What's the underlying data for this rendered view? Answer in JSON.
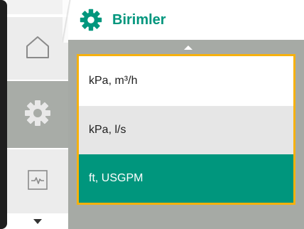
{
  "header": {
    "title": "Birimler",
    "icon": "gear-icon"
  },
  "sidebar": {
    "items": [
      {
        "name": "home",
        "icon": "home-icon",
        "selected": false
      },
      {
        "name": "settings",
        "icon": "gear-icon",
        "selected": true
      },
      {
        "name": "diagnostics",
        "icon": "heartbeat-icon",
        "selected": false
      }
    ],
    "scroll_icon": "chevron-down-icon"
  },
  "units_list": {
    "scroll_icon": "chevron-up-icon",
    "options": [
      {
        "label": "kPa, m³/h",
        "selected": false
      },
      {
        "label": "kPa, l/s",
        "selected": false
      },
      {
        "label": "ft, USGPM",
        "selected": true
      }
    ]
  },
  "colors": {
    "accent": "#00967d",
    "focus_border": "#f6b10e",
    "content_bg": "#a6aaa5",
    "rail_selected": "#a8aca7"
  }
}
